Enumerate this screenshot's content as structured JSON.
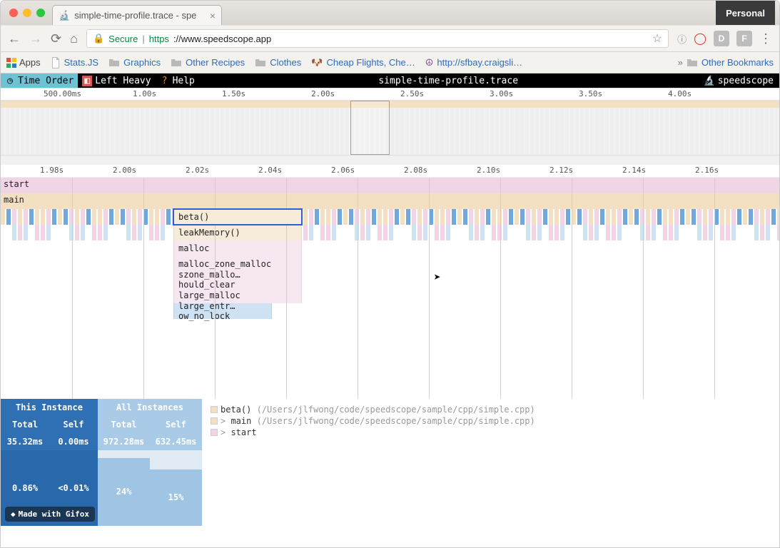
{
  "chrome": {
    "tab_title": "simple-time-profile.trace - spe",
    "personal_label": "Personal",
    "secure_label": "Secure",
    "url_proto": "https",
    "url_rest": "://www.speedscope.app",
    "apps_label": "Apps",
    "bookmarks": [
      "Stats.JS",
      "Graphics",
      "Other Recipes",
      "Clothes",
      "Cheap Flights, Che…",
      "http://sfbay.craigsli…"
    ],
    "other_bookmarks": "Other Bookmarks"
  },
  "appbar": {
    "time_order": "Time Order",
    "left_heavy": "Left Heavy",
    "help": "Help",
    "title": "simple-time-profile.trace",
    "brand": "speedscope"
  },
  "ruler_top": [
    "500.00ms",
    "1.00s",
    "1.50s",
    "2.00s",
    "2.50s",
    "3.00s",
    "3.50s",
    "4.00s"
  ],
  "ruler_zoom": [
    "1.98s",
    "2.00s",
    "2.02s",
    "2.04s",
    "2.06s",
    "2.08s",
    "2.10s",
    "2.12s",
    "2.14s",
    "2.16s"
  ],
  "rows": {
    "start": "start",
    "main": "main"
  },
  "stack": [
    "beta()",
    "leakMemory()",
    "malloc",
    "malloc_zone_malloc",
    "szone_mallo…hould_clear",
    "large_malloc",
    "large_entr…ow_no_lock"
  ],
  "stats": {
    "this_instance": "This Instance",
    "all_instances": "All Instances",
    "total": "Total",
    "self": "Self",
    "ti_total": "35.32ms",
    "ti_self": "0.00ms",
    "ai_total": "972.28ms",
    "ai_self": "632.45ms",
    "ti_total_pct": "0.86%",
    "ti_self_pct": "<0.01%",
    "ai_total_pct": "24%",
    "ai_self_pct": "15%"
  },
  "calltree": {
    "l1_fn": "beta()",
    "l1_path": "(/Users/jlfwong/code/speedscope/sample/cpp/simple.cpp)",
    "l2_fn": "main",
    "l2_path": "(/Users/jlfwong/code/speedscope/sample/cpp/simple.cpp)",
    "l3_fn": "start"
  },
  "gifox": "Made with Gifox"
}
